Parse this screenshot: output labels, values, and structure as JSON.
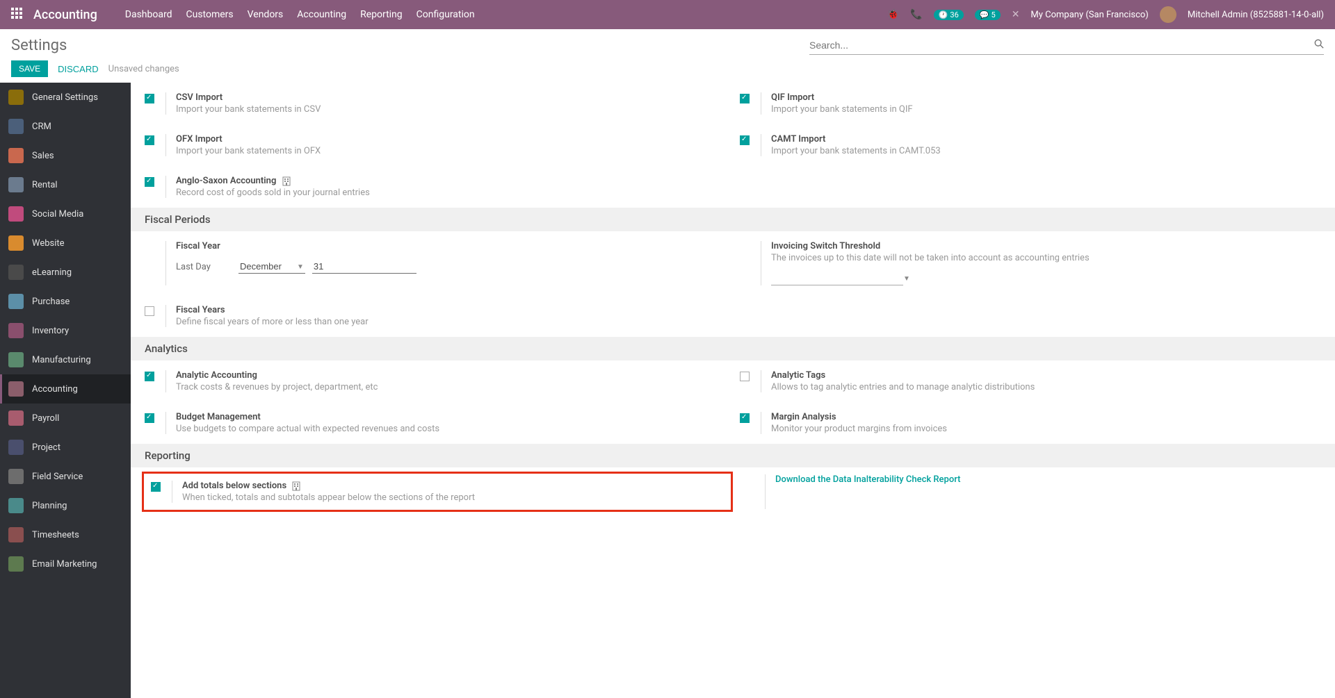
{
  "header": {
    "app_name": "Accounting",
    "menu": [
      "Dashboard",
      "Customers",
      "Vendors",
      "Accounting",
      "Reporting",
      "Configuration"
    ],
    "badge1": "36",
    "badge2": "5",
    "company": "My Company (San Francisco)",
    "user": "Mitchell Admin (8525881-14-0-all)"
  },
  "breadcrumb": {
    "title": "Settings",
    "search_placeholder": "Search..."
  },
  "actions": {
    "save": "SAVE",
    "discard": "DISCARD",
    "unsaved": "Unsaved changes"
  },
  "sidebar": {
    "items": [
      {
        "label": "General Settings",
        "color": "#8a6d0b"
      },
      {
        "label": "CRM",
        "color": "#4b5f7a"
      },
      {
        "label": "Sales",
        "color": "#c9684e"
      },
      {
        "label": "Rental",
        "color": "#6b7b8e"
      },
      {
        "label": "Social Media",
        "color": "#c04b7d"
      },
      {
        "label": "Website",
        "color": "#d98b2e"
      },
      {
        "label": "eLearning",
        "color": "#4a4a4a"
      },
      {
        "label": "Purchase",
        "color": "#5c8fa8"
      },
      {
        "label": "Inventory",
        "color": "#8a4f6d"
      },
      {
        "label": "Manufacturing",
        "color": "#5a8a6d"
      },
      {
        "label": "Accounting",
        "color": "#8b5e6b",
        "active": true
      },
      {
        "label": "Payroll",
        "color": "#a85c6e"
      },
      {
        "label": "Project",
        "color": "#4a4f6d"
      },
      {
        "label": "Field Service",
        "color": "#6d6d6d"
      },
      {
        "label": "Planning",
        "color": "#4a8a8a"
      },
      {
        "label": "Timesheets",
        "color": "#8a4f4f"
      },
      {
        "label": "Email Marketing",
        "color": "#5d7a4f"
      }
    ]
  },
  "settings": {
    "csv": {
      "title": "CSV Import",
      "desc": "Import your bank statements in CSV"
    },
    "qif": {
      "title": "QIF Import",
      "desc": "Import your bank statements in QIF"
    },
    "ofx": {
      "title": "OFX Import",
      "desc": "Import your bank statements in OFX"
    },
    "camt": {
      "title": "CAMT Import",
      "desc": "Import your bank statements in CAMT.053"
    },
    "anglo": {
      "title": "Anglo-Saxon Accounting",
      "desc": "Record cost of goods sold in your journal entries"
    },
    "fiscal_section": "Fiscal Periods",
    "fiscal_year": {
      "title": "Fiscal Year",
      "last_day_label": "Last Day",
      "month": "December",
      "day": "31"
    },
    "threshold": {
      "title": "Invoicing Switch Threshold",
      "desc": "The invoices up to this date will not be taken into account as accounting entries"
    },
    "fiscal_years": {
      "title": "Fiscal Years",
      "desc": "Define fiscal years of more or less than one year"
    },
    "analytics_section": "Analytics",
    "analytic_acc": {
      "title": "Analytic Accounting",
      "desc": "Track costs & revenues by project, department, etc"
    },
    "analytic_tags": {
      "title": "Analytic Tags",
      "desc": "Allows to tag analytic entries and to manage analytic distributions"
    },
    "budget": {
      "title": "Budget Management",
      "desc": "Use budgets to compare actual with expected revenues and costs"
    },
    "margin": {
      "title": "Margin Analysis",
      "desc": "Monitor your product margins from invoices"
    },
    "reporting_section": "Reporting",
    "totals_below": {
      "title": "Add totals below sections",
      "desc": "When ticked, totals and subtotals appear below the sections of the report"
    },
    "download_report": "Download the Data Inalterability Check Report"
  }
}
